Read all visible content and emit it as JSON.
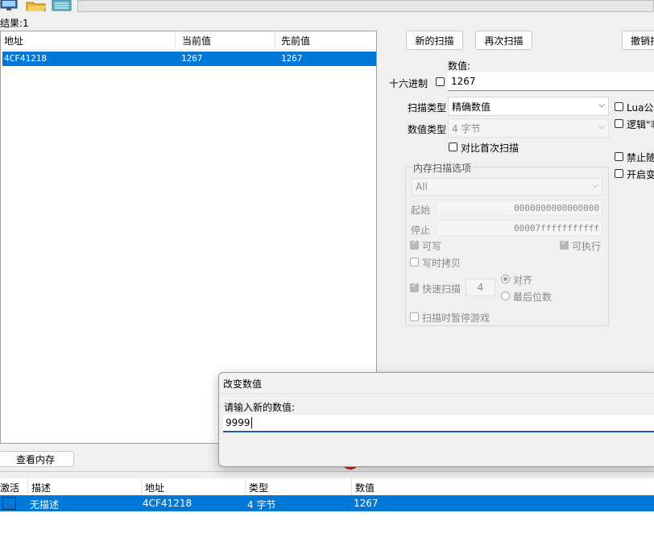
{
  "results": {
    "label": "结果:1"
  },
  "scan_table": {
    "columns": [
      "地址",
      "当前值",
      "先前值"
    ],
    "rows": [
      {
        "address": "4CF41218",
        "current": "1267",
        "previous": "1267"
      }
    ]
  },
  "buttons": {
    "new_scan": "新的扫描",
    "next_scan": "再次扫描",
    "undo_scan": "撤销扫描",
    "view_memory": "查看内存"
  },
  "value": {
    "label": "数值:",
    "hex_label": "十六进制",
    "input": "1267"
  },
  "scan_type": {
    "label": "扫描类型",
    "selected": "精确数值"
  },
  "value_type": {
    "label": "数值类型",
    "selected": "4 字节"
  },
  "compare_first": {
    "label": "对比首次扫描"
  },
  "right_options": {
    "lua_formula": "Lua公式",
    "logic_not": "逻辑\"非\"",
    "no_random": "禁止随机",
    "speedhack": "开启变速精灵"
  },
  "memory_options": {
    "title": "内存扫描选项",
    "region": "All",
    "start_label": "起始",
    "start_value": "0000000000000000",
    "stop_label": "停止",
    "stop_value": "00007fffffffffff",
    "writable": "可写",
    "executable": "可执行",
    "copy_on_write": "写时拷贝",
    "fast_scan": "快速扫描",
    "fast_scan_value": "4",
    "align": "对齐",
    "last_digits": "最后位数",
    "pause_game": "扫描时暂停游戏"
  },
  "address_list": {
    "columns": [
      "激活",
      "描述",
      "地址",
      "类型",
      "数值"
    ],
    "rows": [
      {
        "description": "无描述",
        "address": "4CF41218",
        "type": "4 字节",
        "value": "1267"
      }
    ]
  },
  "dialog": {
    "title": "改变数值",
    "prompt": "请输入新的数值:",
    "input": "9999"
  },
  "colors": {
    "selection": "#0078d7",
    "window_bg": "#f0f0f0"
  }
}
